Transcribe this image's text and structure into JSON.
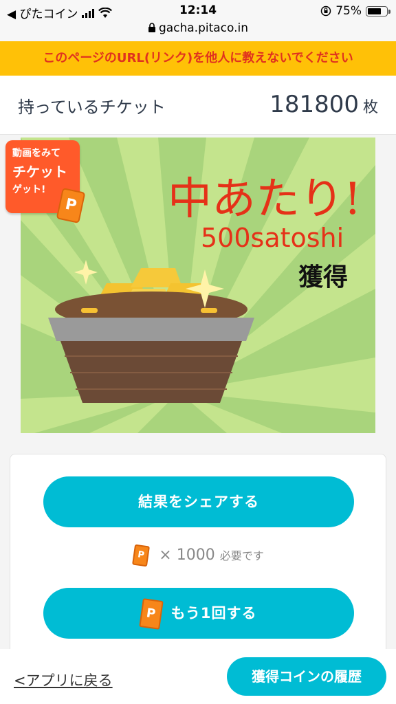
{
  "status_bar": {
    "carrier": "◀ ぴたコイン",
    "time": "12:14",
    "battery_text": "75%",
    "battery_level": 0.75
  },
  "url_bar": {
    "url": "gacha.pitaco.in",
    "icon": "lock-icon"
  },
  "warning": {
    "text": "このページのURL(リンク)を他人に教えないでください"
  },
  "tickets": {
    "label": "持っているチケット",
    "count": "181800",
    "unit": "枚"
  },
  "result": {
    "title": "中あたり!",
    "amount": "500satoshi",
    "obtained": "獲得"
  },
  "video_badge": {
    "line1": "動画をみて",
    "line2": "チケット",
    "line3": "ゲット!",
    "ticket_letter": "P"
  },
  "actions": {
    "share_label": "結果をシェアする",
    "cost_multiplier": "×",
    "cost_amount": "1000",
    "cost_suffix": "必要です",
    "ticket_letter": "P",
    "again_label": "もう1回する"
  },
  "bottom": {
    "back_label": "<アプリに戻る",
    "history_label": "獲得コインの履歴"
  },
  "colors": {
    "accent": "#00bcd4",
    "warning_bg": "#ffc107",
    "warning_text": "#e0321f",
    "hit_text": "#e53118",
    "ticket_orange": "#f7861a"
  }
}
